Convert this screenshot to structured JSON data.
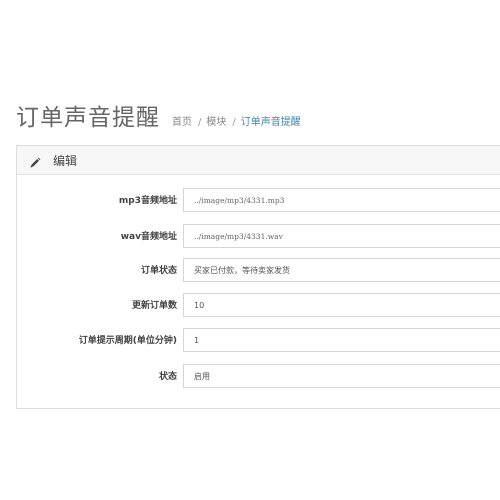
{
  "header": {
    "title": "订单声音提醒",
    "breadcrumb": [
      "首页",
      "模块",
      "订单声音提醒"
    ]
  },
  "panel": {
    "icon": "pencil-icon",
    "title": "编辑"
  },
  "form": {
    "fields": [
      {
        "label": "mp3音频地址",
        "value": "../image/mp3/4331.mp3"
      },
      {
        "label": "wav音频地址",
        "value": "../image/mp3/4331.wav"
      },
      {
        "label": "订单状态",
        "value": "买家已付款，等待卖家发货"
      },
      {
        "label": "更新订单数",
        "value": "10"
      },
      {
        "label": "订单提示周期(单位分钟)",
        "value": "1"
      },
      {
        "label": "状态",
        "value": "启用"
      }
    ]
  },
  "colors": {
    "breadcrumb_active": "#3a87ad",
    "panel_heading_bg": "#f7f7f7"
  }
}
